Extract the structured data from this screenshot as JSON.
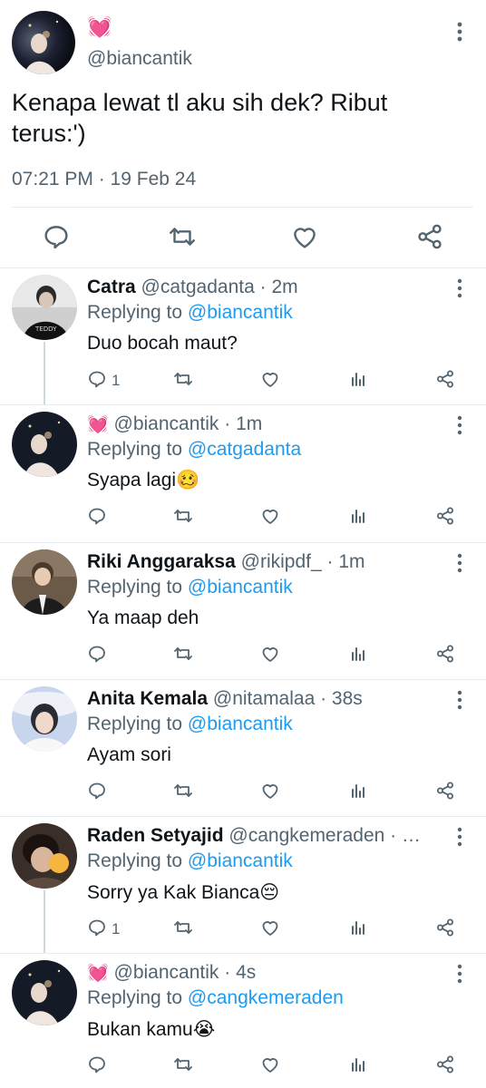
{
  "main_tweet": {
    "heart_emoji": "💓",
    "handle": "@biancantik",
    "text": "Kenapa lewat tl aku sih dek? Ribut terus:')",
    "time": "07:21 PM · 19 Feb 24"
  },
  "replies": [
    {
      "name": "Catra",
      "handle": "@catgadanta",
      "time": "· 2m",
      "replying_label": "Replying to",
      "replying_to": "@biancantik",
      "text": "Duo bocah maut?",
      "reply_count": "1"
    },
    {
      "name": "💓",
      "handle": "@biancantik",
      "time": "· 1m",
      "replying_label": "Replying to",
      "replying_to": "@catgadanta",
      "text": "Syapa lagi🥴",
      "reply_count": ""
    },
    {
      "name": "Riki Anggaraksa",
      "handle": "@rikipdf_",
      "time": "· 1m",
      "replying_label": "Replying to",
      "replying_to": "@biancantik",
      "text": "Ya maap deh",
      "reply_count": ""
    },
    {
      "name": "Anita Kemala",
      "handle": "@nitamalaa",
      "time": "· 38s",
      "replying_label": "Replying to",
      "replying_to": "@biancantik",
      "text": "Ayam sori",
      "reply_count": ""
    },
    {
      "name": "Raden Setyajid",
      "handle": "@cangkemeraden",
      "time": "· …",
      "replying_label": "Replying to",
      "replying_to": "@biancantik",
      "text": "Sorry ya Kak Bianca😔",
      "reply_count": "1"
    },
    {
      "name": "💓",
      "handle": "@biancantik",
      "time": "· 4s",
      "replying_label": "Replying to",
      "replying_to": "@cangkemeraden",
      "text": "Bukan kamu😭",
      "reply_count": ""
    }
  ],
  "colors": {
    "text": "#0f1419",
    "muted": "#536471",
    "link": "#1d9bf0",
    "divider": "#e6ecf0"
  },
  "icons": [
    "reply-icon",
    "retweet-icon",
    "like-icon",
    "analytics-icon",
    "share-icon",
    "more-icon"
  ]
}
